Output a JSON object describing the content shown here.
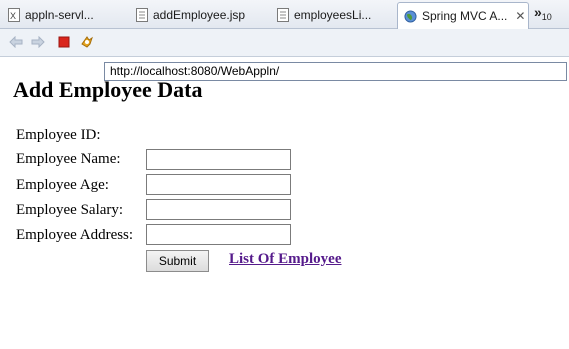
{
  "tabs": [
    {
      "label": "appln-servl...",
      "icon": "xml-file-icon",
      "active": false
    },
    {
      "label": "addEmployee.jsp",
      "icon": "jsp-file-icon",
      "active": false
    },
    {
      "label": "employeesLi...",
      "icon": "jsp-file-icon",
      "active": false
    },
    {
      "label": "Spring MVC A...",
      "icon": "globe-icon",
      "active": true
    }
  ],
  "tab_close": "✕",
  "tab_overflow": {
    "glyph": "»",
    "count": "10"
  },
  "toolbar": {
    "buttons": [
      "back-arrow-icon",
      "forward-arrow-icon",
      "stop-icon",
      "refresh-icon"
    ],
    "url": "http://localhost:8080/WebAppln/"
  },
  "page": {
    "title": "Add Employee Data",
    "fields": [
      {
        "label": "Employee ID:",
        "has_input": false,
        "value": ""
      },
      {
        "label": "Employee Name:",
        "has_input": true,
        "value": ""
      },
      {
        "label": "Employee Age:",
        "has_input": true,
        "value": ""
      },
      {
        "label": "Employee Salary:",
        "has_input": true,
        "value": ""
      },
      {
        "label": "Employee Address:",
        "has_input": true,
        "value": ""
      }
    ],
    "submit_label": "Submit",
    "link_label": "List Of Employee"
  },
  "colors": {
    "link_visited": "#551a8b",
    "stop_red": "#d9251c"
  }
}
